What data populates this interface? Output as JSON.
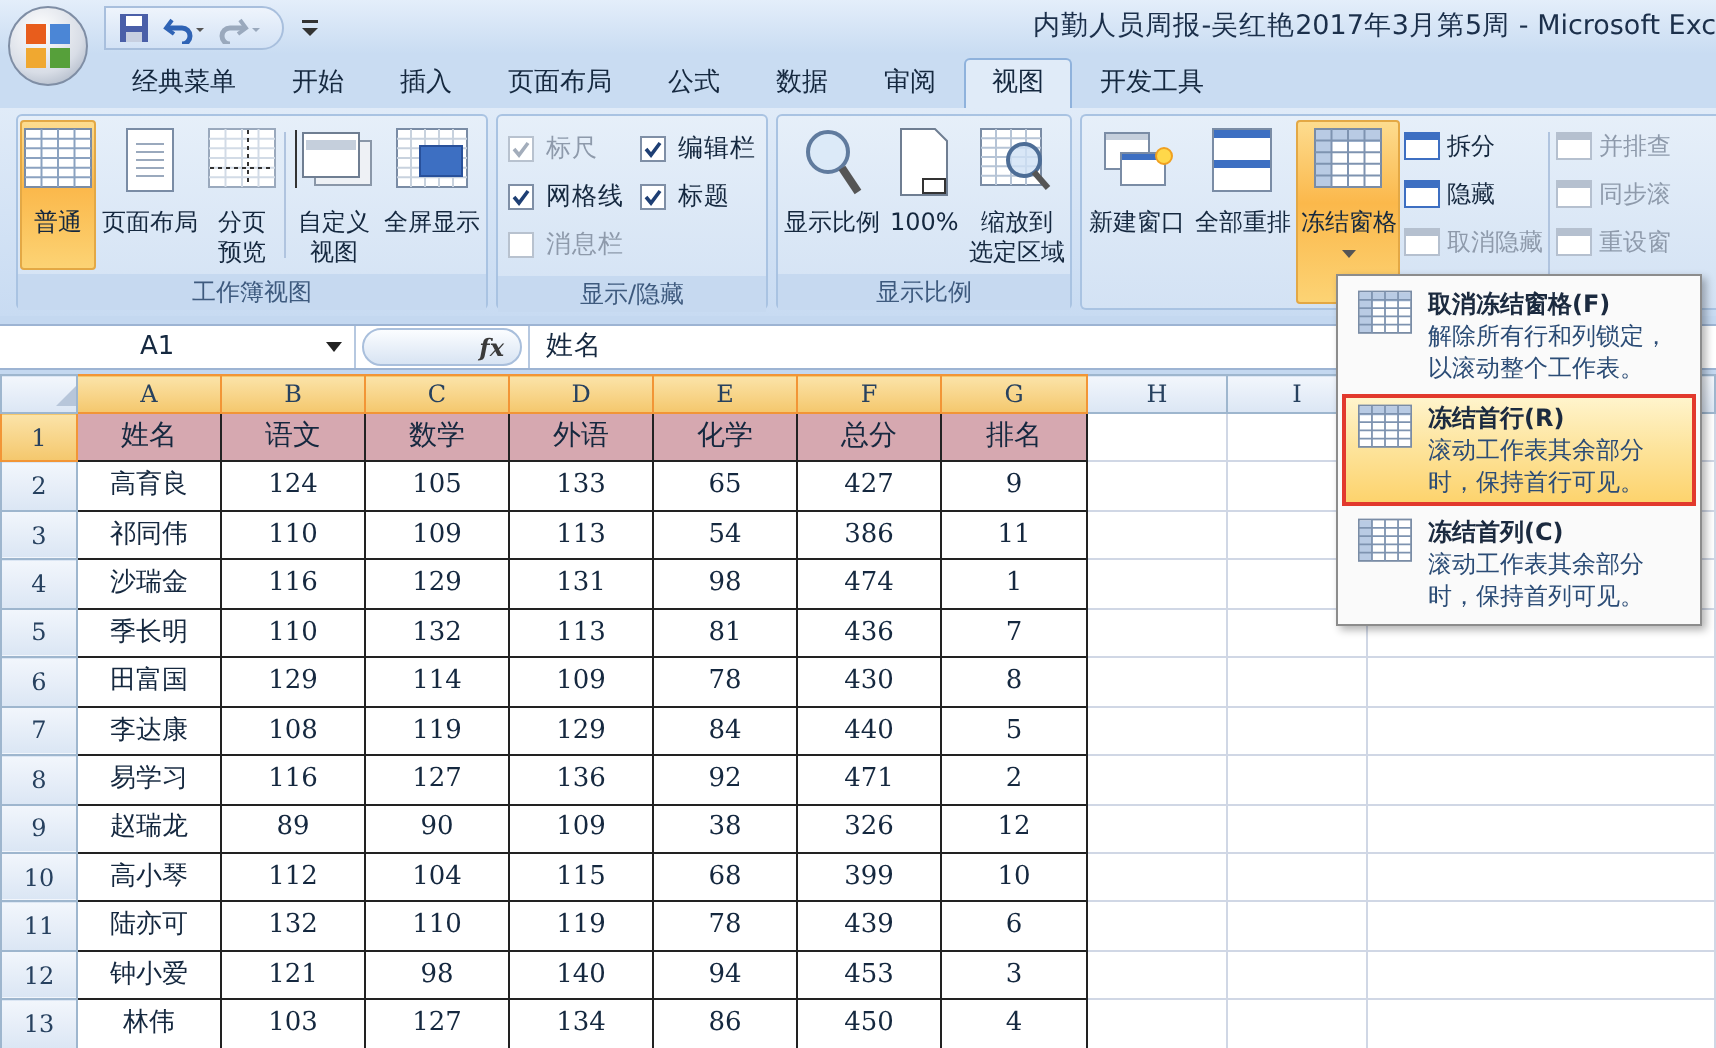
{
  "window": {
    "title": "内勤人员周报-吴红艳2017年3月第5周  -  Microsoft Exc"
  },
  "tabs": [
    {
      "label": "经典菜单",
      "selected": false
    },
    {
      "label": "开始",
      "selected": false
    },
    {
      "label": "插入",
      "selected": false
    },
    {
      "label": "页面布局",
      "selected": false
    },
    {
      "label": "公式",
      "selected": false
    },
    {
      "label": "数据",
      "selected": false
    },
    {
      "label": "审阅",
      "selected": false
    },
    {
      "label": "视图",
      "selected": true
    },
    {
      "label": "开发工具",
      "selected": false
    }
  ],
  "ribbon": {
    "groups": [
      {
        "label": "工作簿视图",
        "sections": [
          [
            {
              "kind": "large",
              "label": "普通",
              "selected": true
            },
            {
              "kind": "large",
              "label": "页面布局",
              "selected": false
            },
            {
              "kind": "large",
              "lines": [
                "分页",
                "预览"
              ],
              "selected": false
            }
          ],
          [
            {
              "kind": "large",
              "lines": [
                "自定义",
                "视图"
              ],
              "selected": false
            },
            {
              "kind": "large",
              "label": "全屏显示",
              "selected": false
            }
          ]
        ]
      },
      {
        "label": "显示/隐藏",
        "sections": [
          [
            {
              "kind": "check",
              "label": "标尺",
              "checked": true,
              "disabled": true
            },
            {
              "kind": "check",
              "label": "网格线",
              "checked": true,
              "disabled": false
            },
            {
              "kind": "check",
              "label": "消息栏",
              "checked": false,
              "disabled": true
            },
            {
              "kind": "check",
              "label": "编辑栏",
              "checked": true,
              "disabled": false
            },
            {
              "kind": "check",
              "label": "标题",
              "checked": true,
              "disabled": false
            }
          ]
        ]
      },
      {
        "label": "显示比例",
        "sections": [
          [
            {
              "kind": "large",
              "label": "显示比例",
              "selected": false
            },
            {
              "kind": "large",
              "label": "100%",
              "selected": false
            },
            {
              "kind": "large",
              "lines": [
                "缩放到",
                "选定区域"
              ],
              "selected": false
            }
          ]
        ]
      },
      {
        "sections": [
          [
            {
              "kind": "large",
              "label": "新建窗口",
              "selected": false
            },
            {
              "kind": "large",
              "label": "全部重排",
              "selected": false
            },
            {
              "kind": "split",
              "label": "冻结窗格",
              "selected": true
            },
            {
              "kind": "small",
              "label": "拆分",
              "disabled": false
            },
            {
              "kind": "small",
              "label": "隐藏",
              "disabled": false
            },
            {
              "kind": "small",
              "label": "取消隐藏",
              "disabled": true
            }
          ],
          [
            {
              "kind": "small",
              "label": "并排查",
              "disabled": true
            },
            {
              "kind": "small",
              "label": "同步滚",
              "disabled": true
            },
            {
              "kind": "small",
              "label": "重设窗",
              "disabled": true
            }
          ]
        ]
      }
    ]
  },
  "formula_bar": {
    "name_box": "A1",
    "function_label": "fx",
    "content": "姓名"
  },
  "sheet": {
    "columns": [
      {
        "label": "A",
        "selected": true
      },
      {
        "label": "B",
        "selected": true
      },
      {
        "label": "C",
        "selected": true
      },
      {
        "label": "D",
        "selected": true
      },
      {
        "label": "E",
        "selected": true
      },
      {
        "label": "F",
        "selected": true
      },
      {
        "label": "G",
        "selected": true
      },
      {
        "label": "H",
        "selected": false
      },
      {
        "label": "I",
        "selected": false
      }
    ],
    "rows": [
      {
        "number": "1",
        "selected": true,
        "kind": "heading",
        "cells": [
          "姓名",
          "语文",
          "数学",
          "外语",
          "化学",
          "总分",
          "排名"
        ]
      },
      {
        "number": "2",
        "selected": false,
        "kind": "data",
        "cells": [
          "高育良",
          "124",
          "105",
          "133",
          "65",
          "427",
          "9"
        ]
      },
      {
        "number": "3",
        "selected": false,
        "kind": "data",
        "cells": [
          "祁同伟",
          "110",
          "109",
          "113",
          "54",
          "386",
          "11"
        ]
      },
      {
        "number": "4",
        "selected": false,
        "kind": "data",
        "cells": [
          "沙瑞金",
          "116",
          "129",
          "131",
          "98",
          "474",
          "1"
        ]
      },
      {
        "number": "5",
        "selected": false,
        "kind": "data",
        "cells": [
          "季长明",
          "110",
          "132",
          "113",
          "81",
          "436",
          "7"
        ]
      },
      {
        "number": "6",
        "selected": false,
        "kind": "data",
        "cells": [
          "田富国",
          "129",
          "114",
          "109",
          "78",
          "430",
          "8"
        ]
      },
      {
        "number": "7",
        "selected": false,
        "kind": "data",
        "cells": [
          "李达康",
          "108",
          "119",
          "129",
          "84",
          "440",
          "5"
        ]
      },
      {
        "number": "8",
        "selected": false,
        "kind": "data",
        "cells": [
          "易学习",
          "116",
          "127",
          "136",
          "92",
          "471",
          "2"
        ]
      },
      {
        "number": "9",
        "selected": false,
        "kind": "data",
        "cells": [
          "赵瑞龙",
          "89",
          "90",
          "109",
          "38",
          "326",
          "12"
        ]
      },
      {
        "number": "10",
        "selected": false,
        "kind": "data",
        "cells": [
          "高小琴",
          "112",
          "104",
          "115",
          "68",
          "399",
          "10"
        ]
      },
      {
        "number": "11",
        "selected": false,
        "kind": "data",
        "cells": [
          "陆亦可",
          "132",
          "110",
          "119",
          "78",
          "439",
          "6"
        ]
      },
      {
        "number": "12",
        "selected": false,
        "kind": "data",
        "cells": [
          "钟小爱",
          "121",
          "98",
          "140",
          "94",
          "453",
          "3"
        ]
      },
      {
        "number": "13",
        "selected": false,
        "kind": "data",
        "cells": [
          "林伟",
          "103",
          "127",
          "134",
          "86",
          "450",
          "4"
        ]
      }
    ]
  },
  "freeze_menu": {
    "items": [
      {
        "title": "取消冻结窗格(F)",
        "description": "解除所有行和列锁定，以滚动整个工作表。",
        "selected": false
      },
      {
        "title": "冻结首行(R)",
        "description": "滚动工作表其余部分时，保持首行可见。",
        "selected": true
      },
      {
        "title": "冻结首列(C)",
        "description": "滚动工作表其余部分时，保持首列可见。",
        "selected": false
      }
    ]
  }
}
